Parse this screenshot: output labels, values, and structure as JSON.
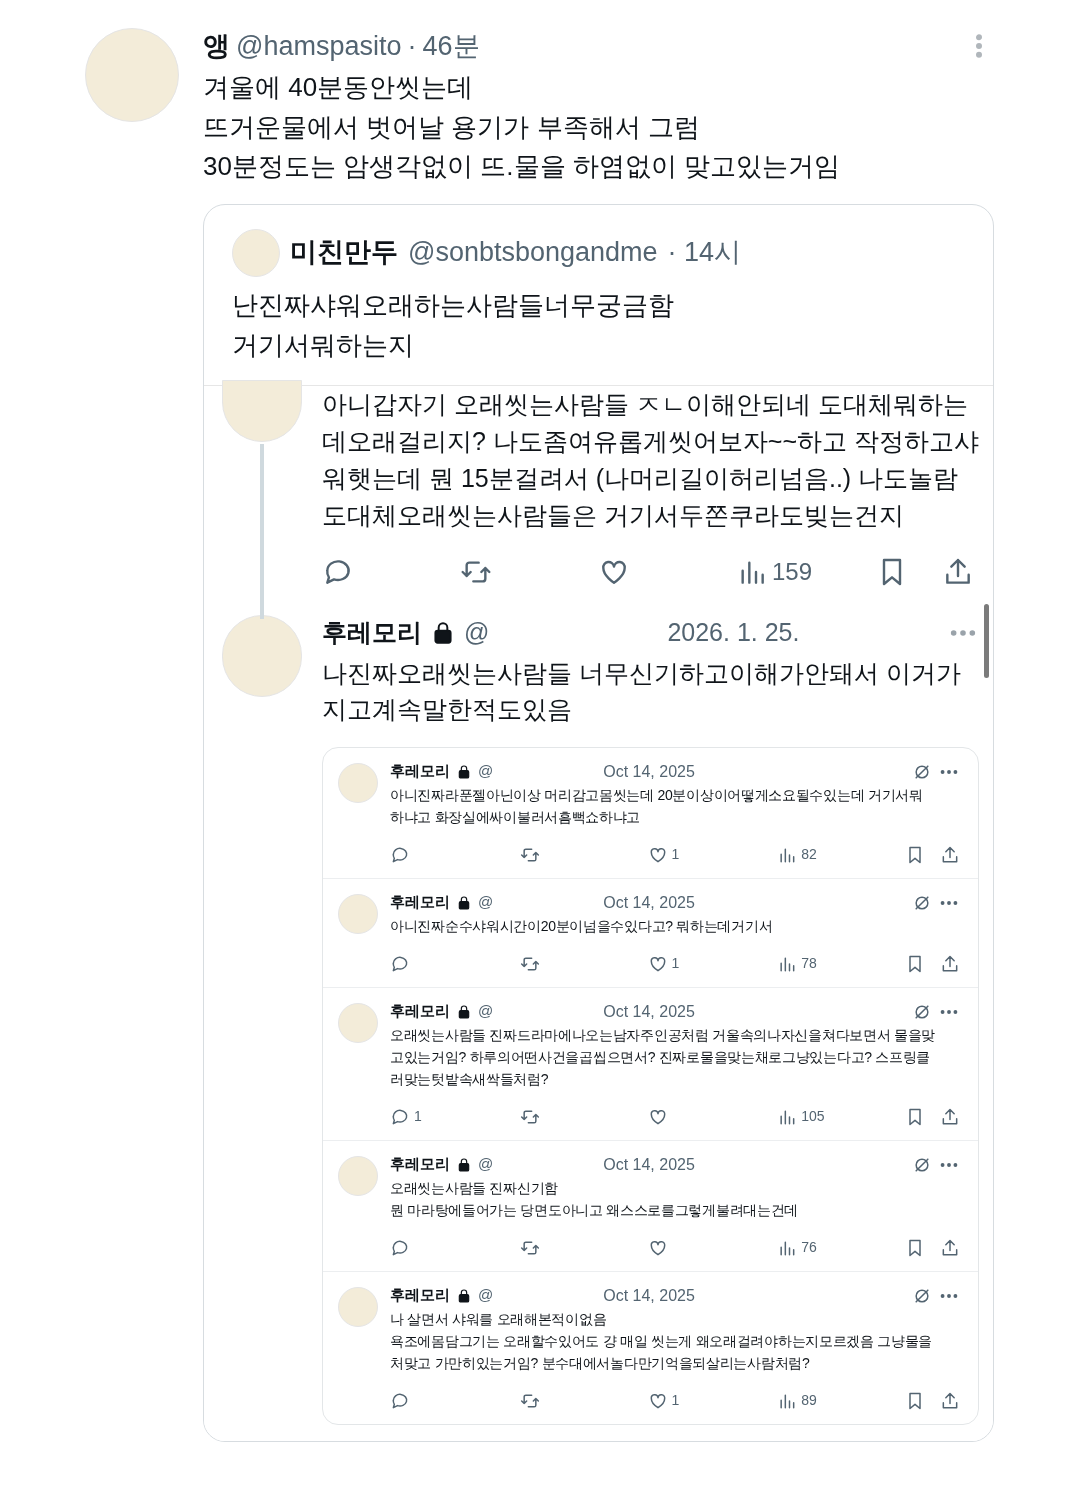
{
  "post": {
    "name": "앵",
    "handle": "@hamspasito",
    "separator": "·",
    "time": "46분",
    "text": "겨울에 40분동안씻는데\n뜨거운물에서 벗어날 용기가 부족해서 그럼\n30분정도는 암생각없이 뜨.물을 하염없이 맞고있는거임"
  },
  "quote": {
    "name": "미친만두",
    "handle": "@sonbtsbongandme",
    "time": "· 14시",
    "text": "난진짜샤워오래하는사람들너무궁금함\n거기서뭐하는지",
    "screenshot": {
      "reply": {
        "text": "아니갑자기 오래씻는사람들 ㅈㄴ이해안되네 도대체뭐하는\n데오래걸리지? 나도좀여유롭게씻어보자~~하고 작정하고샤\n워햇는데 뭔 15분걸려서 (나머리길이허리넘음..) 나도놀람\n도대체오래씻는사람들은 거기서두쫀쿠라도빚는건지",
        "actions": [
          {
            "kind": "reply"
          },
          {
            "kind": "retweet"
          },
          {
            "kind": "like"
          },
          {
            "kind": "views",
            "count": "159"
          },
          {
            "kind": "bookmark"
          },
          {
            "kind": "share"
          }
        ]
      },
      "post": {
        "name": "후레모리",
        "locked": true,
        "handle": "@",
        "date": "2026. 1. 25.",
        "text": "나진짜오래씻는사람들 너무신기하고이해가안돼서 이거가\n지고계속말한적도있음",
        "embedded": [
          {
            "name": "후레모리",
            "locked": true,
            "handle": "@",
            "date": "Oct 14, 2025",
            "text": "아니진짜라푼젤아닌이상 머리감고몸씻는데 20분이상이어떻게소요될수있는데 거기서뭐\n하냐고 화장실에싸이불러서흠뻑쇼하냐고",
            "actions": [
              {
                "kind": "reply"
              },
              {
                "kind": "retweet"
              },
              {
                "kind": "like",
                "count": "1"
              },
              {
                "kind": "views",
                "count": "82"
              },
              {
                "kind": "bookmark"
              },
              {
                "kind": "share"
              }
            ]
          },
          {
            "name": "후레모리",
            "locked": true,
            "handle": "@",
            "date": "Oct 14, 2025",
            "text": "아니진짜순수샤워시간이20분이넘을수있다고? 뭐하는데거기서",
            "actions": [
              {
                "kind": "reply"
              },
              {
                "kind": "retweet"
              },
              {
                "kind": "like",
                "count": "1"
              },
              {
                "kind": "views",
                "count": "78"
              },
              {
                "kind": "bookmark"
              },
              {
                "kind": "share"
              }
            ]
          },
          {
            "name": "후레모리",
            "locked": true,
            "handle": "@",
            "date": "Oct 14, 2025",
            "text": "오래씻는사람들 진짜드라마에나오는남자주인공처럼 거울속의나자신을쳐다보면서 물을맞\n고있는거임? 하루의어떤사건을곱씹으면서? 진짜로물을맞는채로그냥있는다고? 스프링클\n러맞는텃밭속새싹들처럼?",
            "actions": [
              {
                "kind": "reply",
                "count": "1"
              },
              {
                "kind": "retweet"
              },
              {
                "kind": "like"
              },
              {
                "kind": "views",
                "count": "105"
              },
              {
                "kind": "bookmark"
              },
              {
                "kind": "share"
              }
            ]
          },
          {
            "name": "후레모리",
            "locked": true,
            "handle": "@",
            "date": "Oct 14, 2025",
            "text": "오래씻는사람들 진짜신기함\n뭔 마라탕에들어가는 당면도아니고 왜스스로를그렇게불려대는건데",
            "actions": [
              {
                "kind": "reply"
              },
              {
                "kind": "retweet"
              },
              {
                "kind": "like"
              },
              {
                "kind": "views",
                "count": "76"
              },
              {
                "kind": "bookmark"
              },
              {
                "kind": "share"
              }
            ]
          },
          {
            "name": "후레모리",
            "locked": true,
            "handle": "@",
            "date": "Oct 14, 2025",
            "text": "나 살면서 샤워를 오래해본적이없음\n욕조에몸담그기는 오래할수있어도 걍 매일 씻는게 왜오래걸려야하는지모르겠음 그냥물을\n처맞고 가만히있는거임? 분수대에서놀다만기억을되살리는사람처럼?",
            "actions": [
              {
                "kind": "reply"
              },
              {
                "kind": "retweet"
              },
              {
                "kind": "like",
                "count": "1"
              },
              {
                "kind": "views",
                "count": "89"
              },
              {
                "kind": "bookmark"
              },
              {
                "kind": "share"
              }
            ]
          }
        ]
      }
    }
  }
}
